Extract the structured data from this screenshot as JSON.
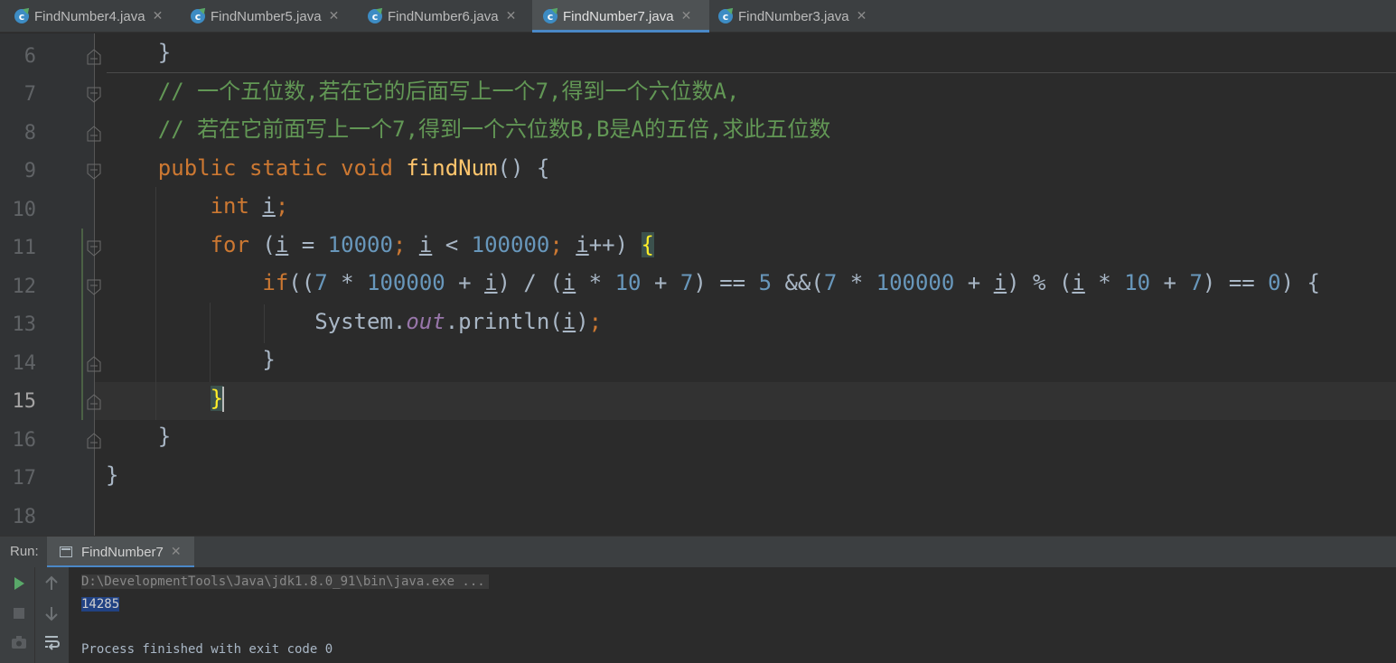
{
  "tabs": [
    {
      "label": "FindNumber4.java",
      "active": false
    },
    {
      "label": "FindNumber5.java",
      "active": false
    },
    {
      "label": "FindNumber6.java",
      "active": false
    },
    {
      "label": "FindNumber7.java",
      "active": true
    },
    {
      "label": "FindNumber3.java",
      "active": false
    }
  ],
  "editor": {
    "line_numbers": [
      "6",
      "7",
      "8",
      "9",
      "10",
      "11",
      "12",
      "13",
      "14",
      "15",
      "16",
      "17",
      "18"
    ],
    "current_line": "15",
    "lines": [
      "    }",
      "    // 一个五位数,若在它的后面写上一个7,得到一个六位数A,",
      "    // 若在它前面写上一个7,得到一个六位数B,B是A的五倍,求此五位数",
      "    public static void findNum() {",
      "        int i;",
      "        for (i = 10000; i < 100000; i++) {",
      "            if((7 * 100000 + i) / (i * 10 + 7) == 5 &&(7 * 100000 + i) % (i * 10 + 7) == 0) {",
      "                System.out.println(i);",
      "            }",
      "        }",
      "    }",
      "}",
      ""
    ]
  },
  "run": {
    "label": "Run:",
    "tab_label": "FindNumber7",
    "console": {
      "command": "D:\\DevelopmentTools\\Java\\jdk1.8.0_91\\bin\\java.exe ...",
      "output": "14285",
      "finished": "Process finished with exit code 0"
    }
  },
  "colors": {
    "background": "#2b2b2b",
    "keyword": "#cc7832",
    "comment": "#629755",
    "function": "#ffc66d",
    "number": "#6897bb",
    "static_field": "#9876aa",
    "accent": "#4a88c7"
  },
  "icons": [
    "java-class-icon",
    "close-icon",
    "fold-marker-icon",
    "run-icon",
    "stop-icon",
    "camera-icon",
    "up-arrow-icon",
    "down-arrow-icon",
    "soft-wrap-icon",
    "console-icon"
  ]
}
